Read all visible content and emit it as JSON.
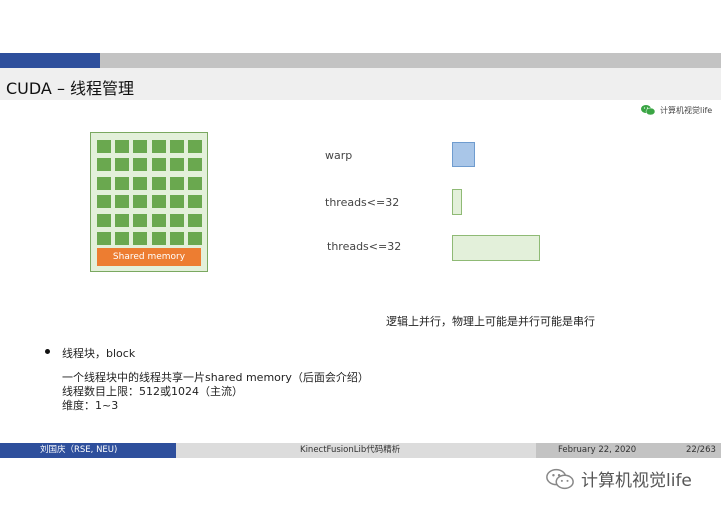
{
  "slide": {
    "title": "CUDA – 线程管理"
  },
  "watermark_small": {
    "icon": "wechat-icon",
    "text": "计算机视觉life"
  },
  "diagram": {
    "shared_memory_label": "Shared memory",
    "thread_grid": {
      "rows": 6,
      "cols": 6
    },
    "legend": [
      {
        "label": "warp"
      },
      {
        "label": "threads<=32"
      },
      {
        "label": "threads<=32"
      }
    ],
    "colors": {
      "block_fill": "#e3f0da",
      "thread": "#6aa84f",
      "shared_memory": "#ed7d31",
      "warp": "#a9c6e8"
    }
  },
  "note": "逻辑上并行，物理上可能是并行可能是串行",
  "bullet": {
    "title": "线程块，block",
    "lines": [
      "一个线程块中的线程共享一片shared memory（后面会介绍）",
      "线程数目上限：512或1024（主流）",
      "维度：1~3"
    ]
  },
  "footer": {
    "author": "刘国庆（RSE, NEU)",
    "subject": "KinectFusionLib代码精析",
    "date": "February 22, 2020",
    "page": "22/263"
  },
  "watermark_large": {
    "icon": "wechat-icon",
    "text": "计算机视觉life"
  }
}
